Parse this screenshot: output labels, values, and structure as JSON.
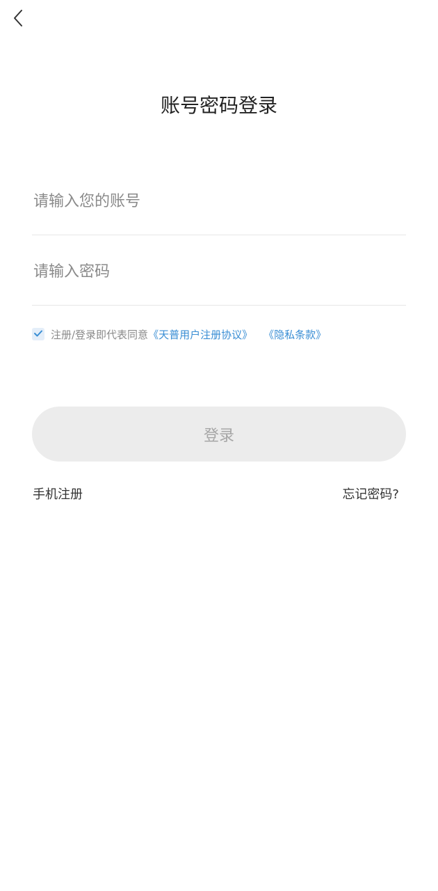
{
  "header": {
    "back_icon": "chevron-left-icon",
    "title": "账号密码登录"
  },
  "form": {
    "account_placeholder": "请输入您的账号",
    "account_value": "",
    "password_placeholder": "请输入密码",
    "password_value": ""
  },
  "agreement": {
    "checked": true,
    "text": "注册/登录即代表同意",
    "user_agreement_link": "《天普用户注册协议》",
    "privacy_link": "《隐私条款》"
  },
  "login_button": {
    "label": "登录"
  },
  "footer_links": {
    "register": "手机注册",
    "forgot_password": "忘记密码?"
  },
  "colors": {
    "link": "#3a8ed4",
    "button_bg": "#ececec",
    "button_text": "#a6a6a6",
    "placeholder": "#8a8a8a",
    "title": "#222222"
  }
}
